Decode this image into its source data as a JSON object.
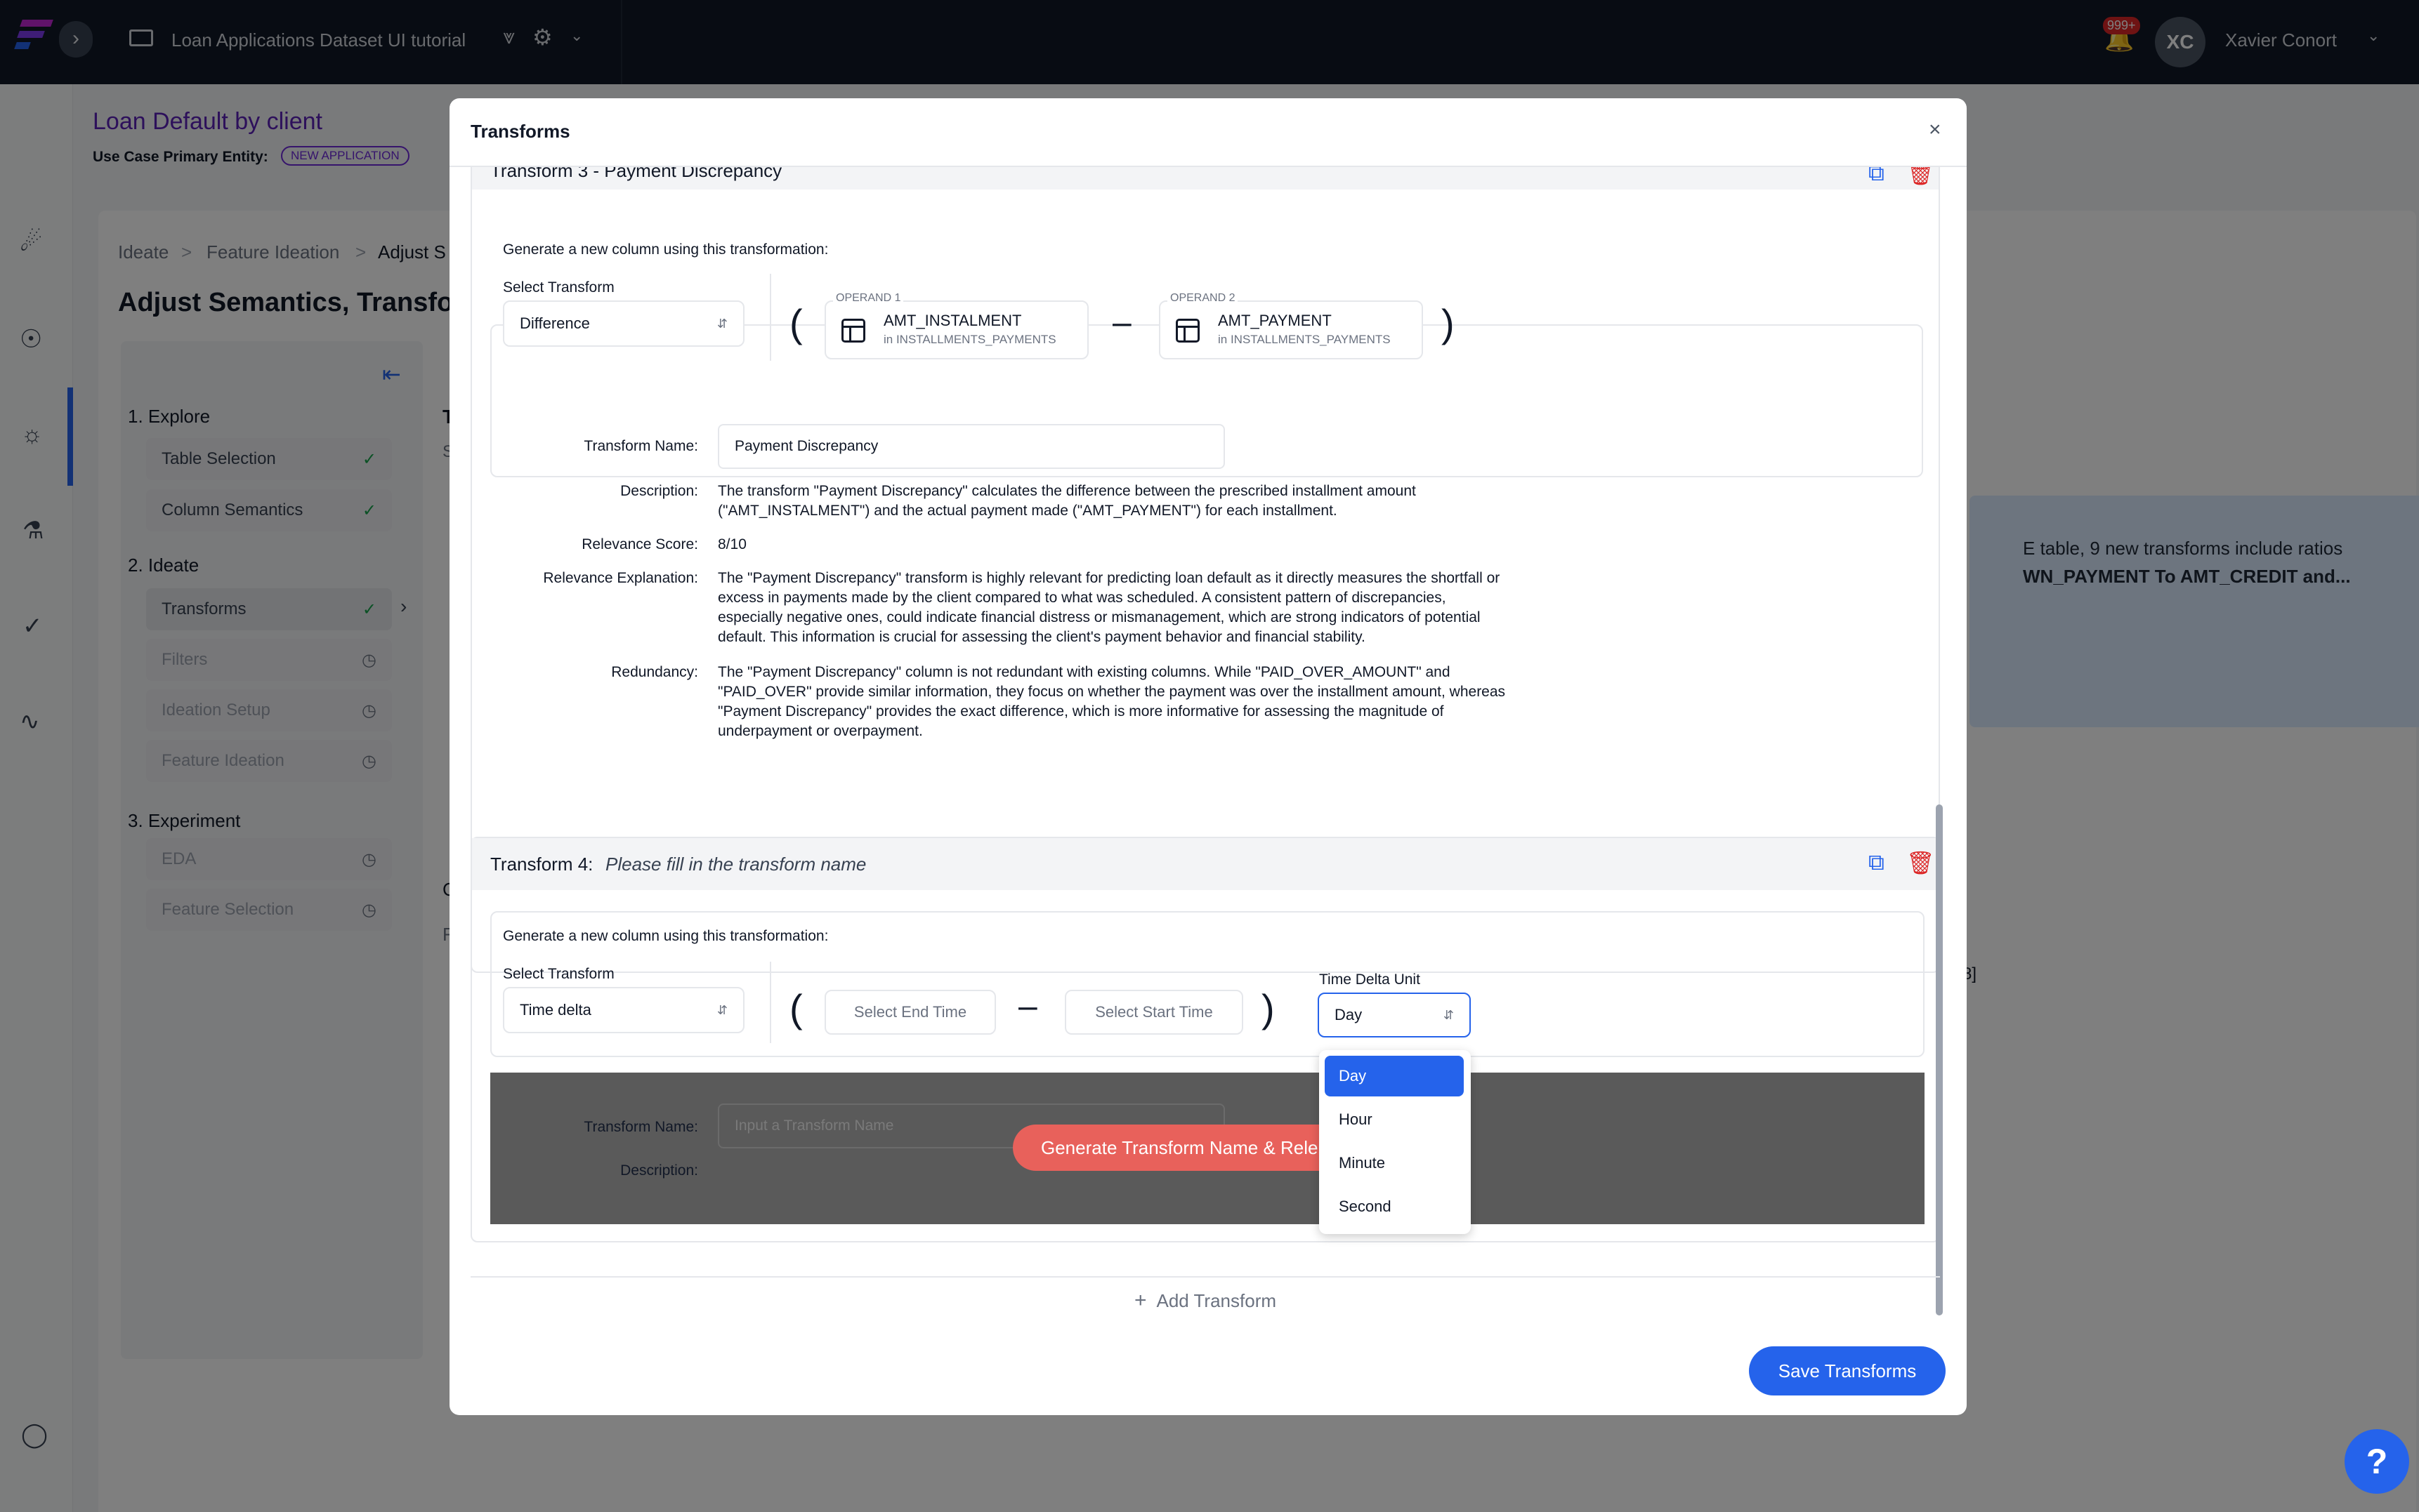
{
  "header": {
    "app_title": "Loan Applications Dataset UI tutorial",
    "notifications_badge": "999+",
    "avatar_initials": "XC",
    "user_name": "Xavier Conort"
  },
  "use_case": {
    "title": "Loan Default by client",
    "primary_entity_label": "Use Case Primary Entity:",
    "primary_entity_value": "NEW APPLICATION"
  },
  "breadcrumb": [
    "Ideate",
    "Feature Ideation",
    "Adjust S"
  ],
  "page_title": "Adjust Semantics, Transfor",
  "steps": {
    "sections": [
      "1. Explore",
      "2. Ideate",
      "3. Experiment"
    ],
    "items": [
      {
        "label": "Table Selection",
        "status": "done"
      },
      {
        "label": "Column Semantics",
        "status": "done"
      },
      {
        "label": "Transforms",
        "status": "done"
      },
      {
        "label": "Filters",
        "status": "pending"
      },
      {
        "label": "Ideation Setup",
        "status": "pending"
      },
      {
        "label": "Feature Ideation",
        "status": "pending"
      },
      {
        "label": "EDA",
        "status": "pending"
      },
      {
        "label": "Feature Selection",
        "status": "pending"
      }
    ]
  },
  "background_fragments": {
    "line1": "E table, 9 new transforms include ratios",
    "line2": "WN_PAYMENT To AMT_CREDIT and...",
    "side1": "T",
    "side2": "S",
    "side3": "C",
    "side4": "F",
    "bracket": "8]"
  },
  "modal": {
    "title": "Transforms",
    "transform3": {
      "header": "Transform 3 - Payment Discrepancy",
      "generate_label": "Generate a new column using this transformation:",
      "select_transform_label": "Select Transform",
      "select_transform_value": "Difference",
      "operand1_caption": "OPERAND 1",
      "operand1_name": "AMT_INSTALMENT",
      "operand1_table": "in INSTALLMENTS_PAYMENTS",
      "operand2_caption": "OPERAND 2",
      "operand2_name": "AMT_PAYMENT",
      "operand2_table": "in INSTALLMENTS_PAYMENTS",
      "labels": {
        "name": "Transform Name:",
        "description": "Description:",
        "score": "Relevance Score:",
        "explanation": "Relevance Explanation:",
        "redundancy": "Redundancy:"
      },
      "name_value": "Payment Discrepancy",
      "description_lines": [
        "The transform \"Payment Discrepancy\" calculates the difference between the prescribed installment amount",
        "(\"AMT_INSTALMENT\") and the actual payment made (\"AMT_PAYMENT\") for each installment."
      ],
      "relevance_score": "8/10",
      "explanation_lines": [
        "The \"Payment Discrepancy\" transform is highly relevant for predicting loan default as it directly measures the shortfall or",
        "excess in payments made by the client compared to what was scheduled. A consistent pattern of discrepancies,",
        "especially negative ones, could indicate financial distress or mismanagement, which are strong indicators of potential",
        "default. This information is crucial for assessing the client's payment behavior and financial stability."
      ],
      "redundancy_lines": [
        "The \"Payment Discrepancy\" column is not redundant with existing columns. While \"PAID_OVER_AMOUNT\" and",
        "\"PAID_OVER\" provide similar information, they focus on whether the payment was over the installment amount, whereas",
        "\"Payment Discrepancy\" provides the exact difference, which is more informative for assessing the magnitude of",
        "underpayment or overpayment."
      ]
    },
    "transform4": {
      "header_prefix": "Transform 4:",
      "header_placeholder": "Please fill in the transform name",
      "generate_label": "Generate a new column using this transformation:",
      "select_transform_label": "Select Transform",
      "select_transform_value": "Time delta",
      "end_time_placeholder": "Select End Time",
      "start_time_placeholder": "Select Start Time",
      "time_delta_label": "Time Delta Unit",
      "time_delta_value": "Day",
      "time_delta_options": [
        "Day",
        "Hour",
        "Minute",
        "Second"
      ],
      "name_label": "Transform Name:",
      "name_placeholder": "Input a Transform Name",
      "description_label": "Description:",
      "generate_button": "Generate Transform Name & Rele"
    },
    "add_transform": "Add Transform",
    "save_button": "Save Transforms"
  },
  "help_button": "?",
  "colors": {
    "topbar": "#111827",
    "accent_purple": "#5b21b6",
    "primary_blue": "#2563eb",
    "danger_red": "#dc2626",
    "generate_red": "#e8615b"
  }
}
